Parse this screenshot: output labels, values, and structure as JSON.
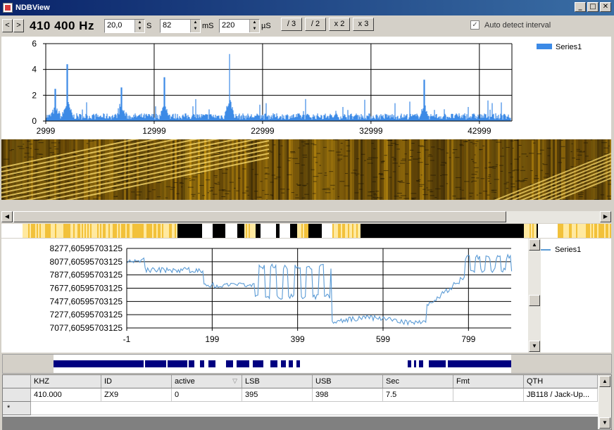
{
  "window": {
    "title": "NDBView",
    "buttons": [
      "_",
      "□",
      "✕"
    ]
  },
  "toolbar": {
    "prev_label": "<",
    "next_label": ">",
    "frequency": "410 400 Hz",
    "interval_value": "20,0",
    "interval_unit": "S",
    "ms_value": "82",
    "ms_unit": "mS",
    "us_value": "220",
    "us_unit": "µS",
    "div3_label": "/ 3",
    "div2_label": "/ 2",
    "mul2_label": "x 2",
    "mul3_label": "x 3",
    "auto_detect_label": "Auto detect interval",
    "auto_detect_checked": true
  },
  "chart_top": {
    "legend": "Series1",
    "series_color": "#3c8ae6",
    "yticks": [
      "6",
      "4",
      "2",
      "0"
    ],
    "xticks": [
      "2999",
      "12999",
      "22999",
      "32999",
      "42999"
    ]
  },
  "chart_bottom": {
    "legend": "Series1",
    "series_color": "#5b9bd5",
    "yticks": [
      "8277,60595703125",
      "8077,60595703125",
      "7877,60595703125",
      "7677,60595703125",
      "7477,60595703125",
      "7277,60595703125",
      "7077,60595703125"
    ],
    "xticks": [
      "-1",
      "199",
      "399",
      "599",
      "799"
    ]
  },
  "chart_data": [
    {
      "type": "line",
      "series": [
        {
          "name": "Series1",
          "peaks": [
            {
              "x": 5000,
              "y": 4.4
            },
            {
              "x": 3900,
              "y": 2.5
            },
            {
              "x": 10000,
              "y": 2.6
            },
            {
              "x": 14000,
              "y": 3.4
            },
            {
              "x": 20000,
              "y": 5.2
            },
            {
              "x": 38000,
              "y": 3.2
            }
          ],
          "baseline": 0.4
        }
      ],
      "ylim": [
        0,
        6
      ],
      "xlim": [
        2999,
        45999
      ],
      "grid": true,
      "legend_position": "top-right"
    },
    {
      "type": "line",
      "series": [
        {
          "name": "Series1"
        }
      ],
      "ylim": [
        7077.60595703125,
        8277.60595703125
      ],
      "xlim": [
        -1,
        899
      ],
      "grid": true,
      "legend_position": "top-right"
    }
  ],
  "bits_strip_color": "#000080",
  "table": {
    "columns": [
      "KHZ",
      "ID",
      "active",
      "LSB",
      "USB",
      "Sec",
      "Fmt",
      "QTH"
    ],
    "rows": [
      [
        "410.000",
        "ZX9",
        "0",
        "395",
        "398",
        "7.5",
        "",
        "JB118 / Jack-Up..."
      ]
    ],
    "new_row_marker": "*"
  }
}
